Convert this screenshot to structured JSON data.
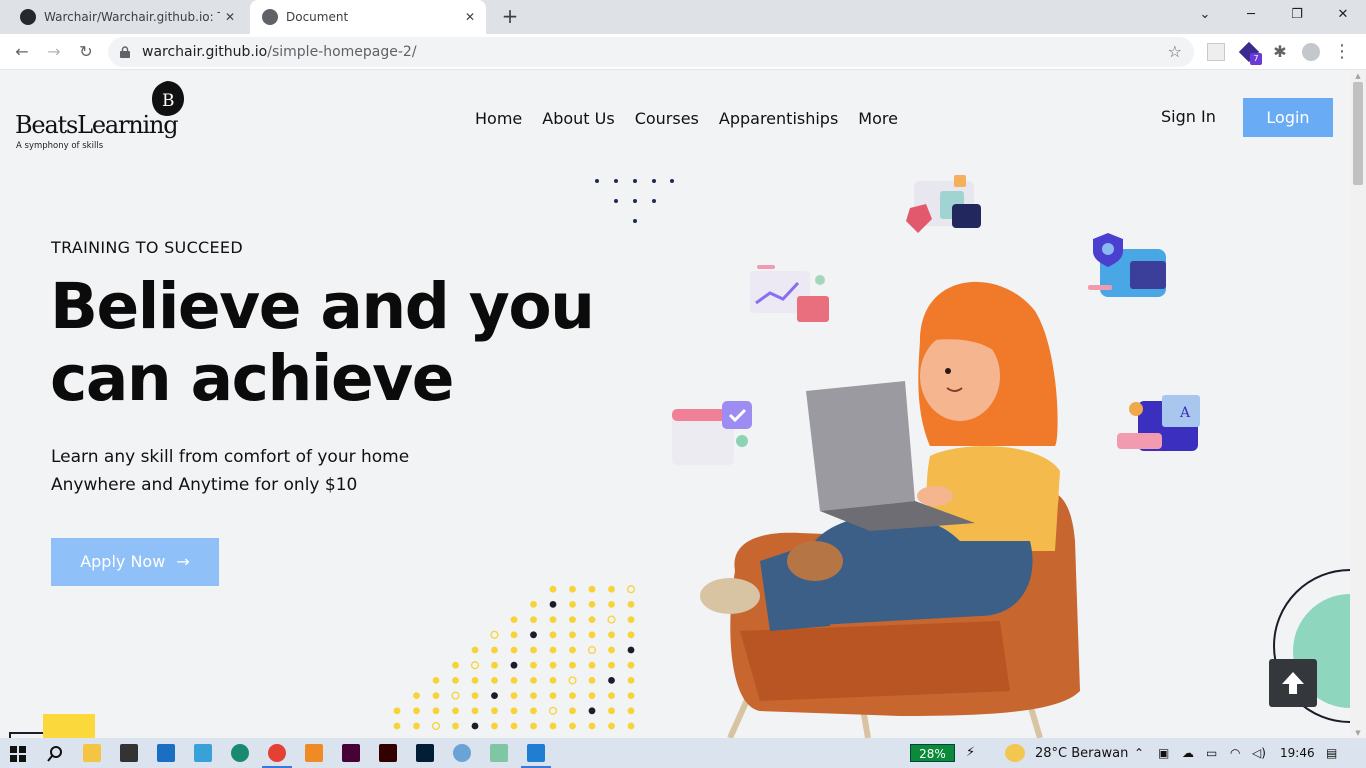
{
  "browser": {
    "tabs": [
      {
        "title": "Warchair/Warchair.github.io: This",
        "active": false
      },
      {
        "title": "Document",
        "active": true
      }
    ],
    "new_tab": "+",
    "window_controls": {
      "minimize": "─",
      "restore": "❐",
      "close": "✕",
      "dropdown": "⌄"
    },
    "url_host": "warchair.github.io",
    "url_path": "/simple-homepage-2/",
    "extension_badge": "7"
  },
  "site": {
    "logo_mark": "B",
    "brand": "BeatsLearning",
    "tagline": "A symphony of skills",
    "nav": [
      "Home",
      "About Us",
      "Courses",
      "Apparentiships",
      "More"
    ],
    "sign_in": "Sign In",
    "login": "Login"
  },
  "hero": {
    "eyebrow": "TRAINING TO SUCCEED",
    "headline_line1": "Believe and you",
    "headline_line2": "can achieve",
    "sub_line1": "Learn any skill from comfort of your home",
    "sub_line2": "Anywhere and Anytime for only $10",
    "cta": "Apply Now",
    "cta_arrow": "→"
  },
  "colors": {
    "accent_blue": "#6aabf5",
    "cta_blue": "#8fc0f7",
    "dot_yellow": "#f7d33a",
    "dot_dark": "#1c1c2b",
    "chair_orange": "#c8662f",
    "hair_orange": "#f07a2a",
    "mint": "#8fd6be"
  },
  "taskbar": {
    "battery": "28%",
    "weather": "28°C  Berawan",
    "clock": "19:46"
  }
}
